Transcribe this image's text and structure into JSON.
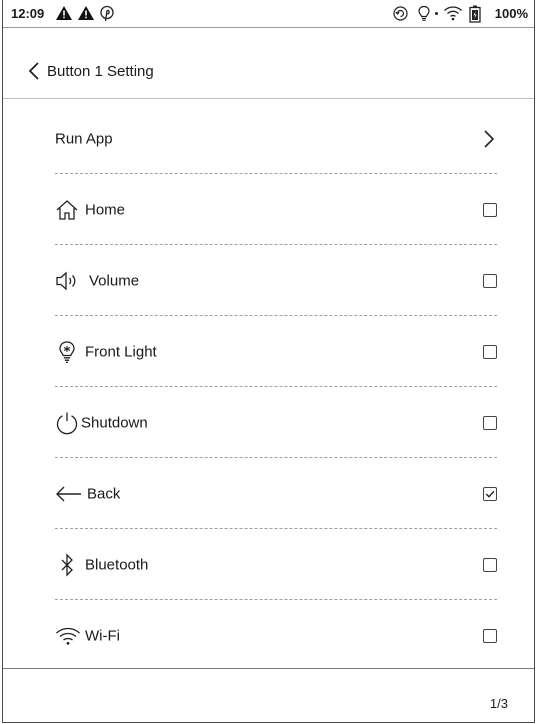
{
  "status_bar": {
    "time": "12:09",
    "battery": "100%"
  },
  "header": {
    "title": "Button 1 Setting"
  },
  "items": [
    {
      "label": "Run App",
      "control": "chevron"
    },
    {
      "label": "Home",
      "icon": "home-icon",
      "checked": false
    },
    {
      "label": "Volume",
      "icon": "volume-icon",
      "checked": false
    },
    {
      "label": "Front Light",
      "icon": "light-bulb-icon",
      "checked": false
    },
    {
      "label": "Shutdown",
      "icon": "power-icon",
      "checked": false
    },
    {
      "label": "Back",
      "icon": "back-arrow-icon",
      "checked": true
    },
    {
      "label": "Bluetooth",
      "icon": "bluetooth-icon",
      "checked": false
    },
    {
      "label": "Wi-Fi",
      "icon": "wifi-icon",
      "checked": false
    }
  ],
  "pagination": {
    "page": "1/3"
  }
}
